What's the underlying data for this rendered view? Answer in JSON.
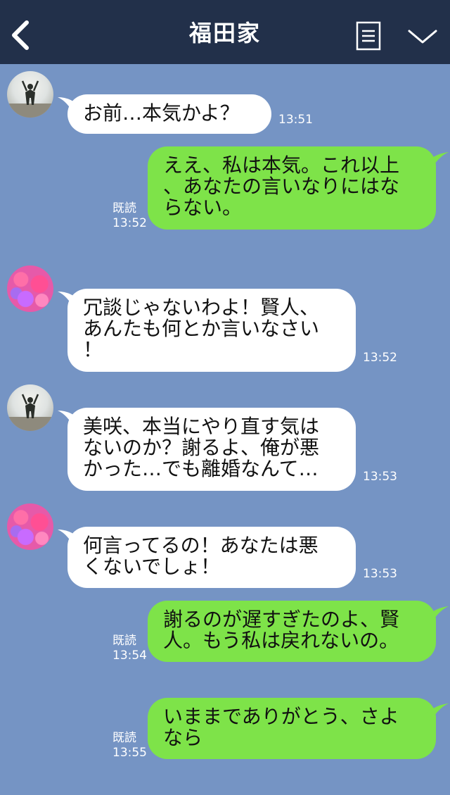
{
  "colors": {
    "background": "#7594c4",
    "header": "#22304a",
    "green": "#7ee349"
  },
  "header": {
    "title": "福田家",
    "back_icon": "chevron-left-icon",
    "menu_icon": "menu-icon",
    "more_icon": "chevron-down-icon"
  },
  "messages": [
    {
      "side": "left",
      "lines": [
        "お前…本気かよ？"
      ],
      "time": "13:51"
    },
    {
      "side": "right",
      "lines": [
        "ええ、私は本気。これ以上",
        "、あなたの言いなりにはな",
        "らない。"
      ],
      "read": "既読",
      "time": "13:52"
    },
    {
      "side": "left",
      "lines": [
        "冗談じゃないわよ！賢人、",
        "あんたも何とか言いなさい",
        "！"
      ],
      "time": "13:52"
    },
    {
      "side": "left",
      "lines": [
        "美咲、本当にやり直す気は",
        "ないのか？謝るよ、俺が悪",
        "かった…でも離婚なんて…"
      ],
      "time": "13:53"
    },
    {
      "side": "left",
      "lines": [
        "何言ってるの！あなたは悪",
        "くないでしょ！"
      ],
      "time": "13:53"
    },
    {
      "side": "right",
      "lines": [
        "謝るのが遅すぎたのよ、賢",
        "人。もう私は戻れないの。"
      ],
      "read": "既読",
      "time": "13:54"
    },
    {
      "side": "right",
      "lines": [
        "いままでありがとう、さよ",
        "なら"
      ],
      "read": "既読",
      "time": "13:55"
    }
  ]
}
